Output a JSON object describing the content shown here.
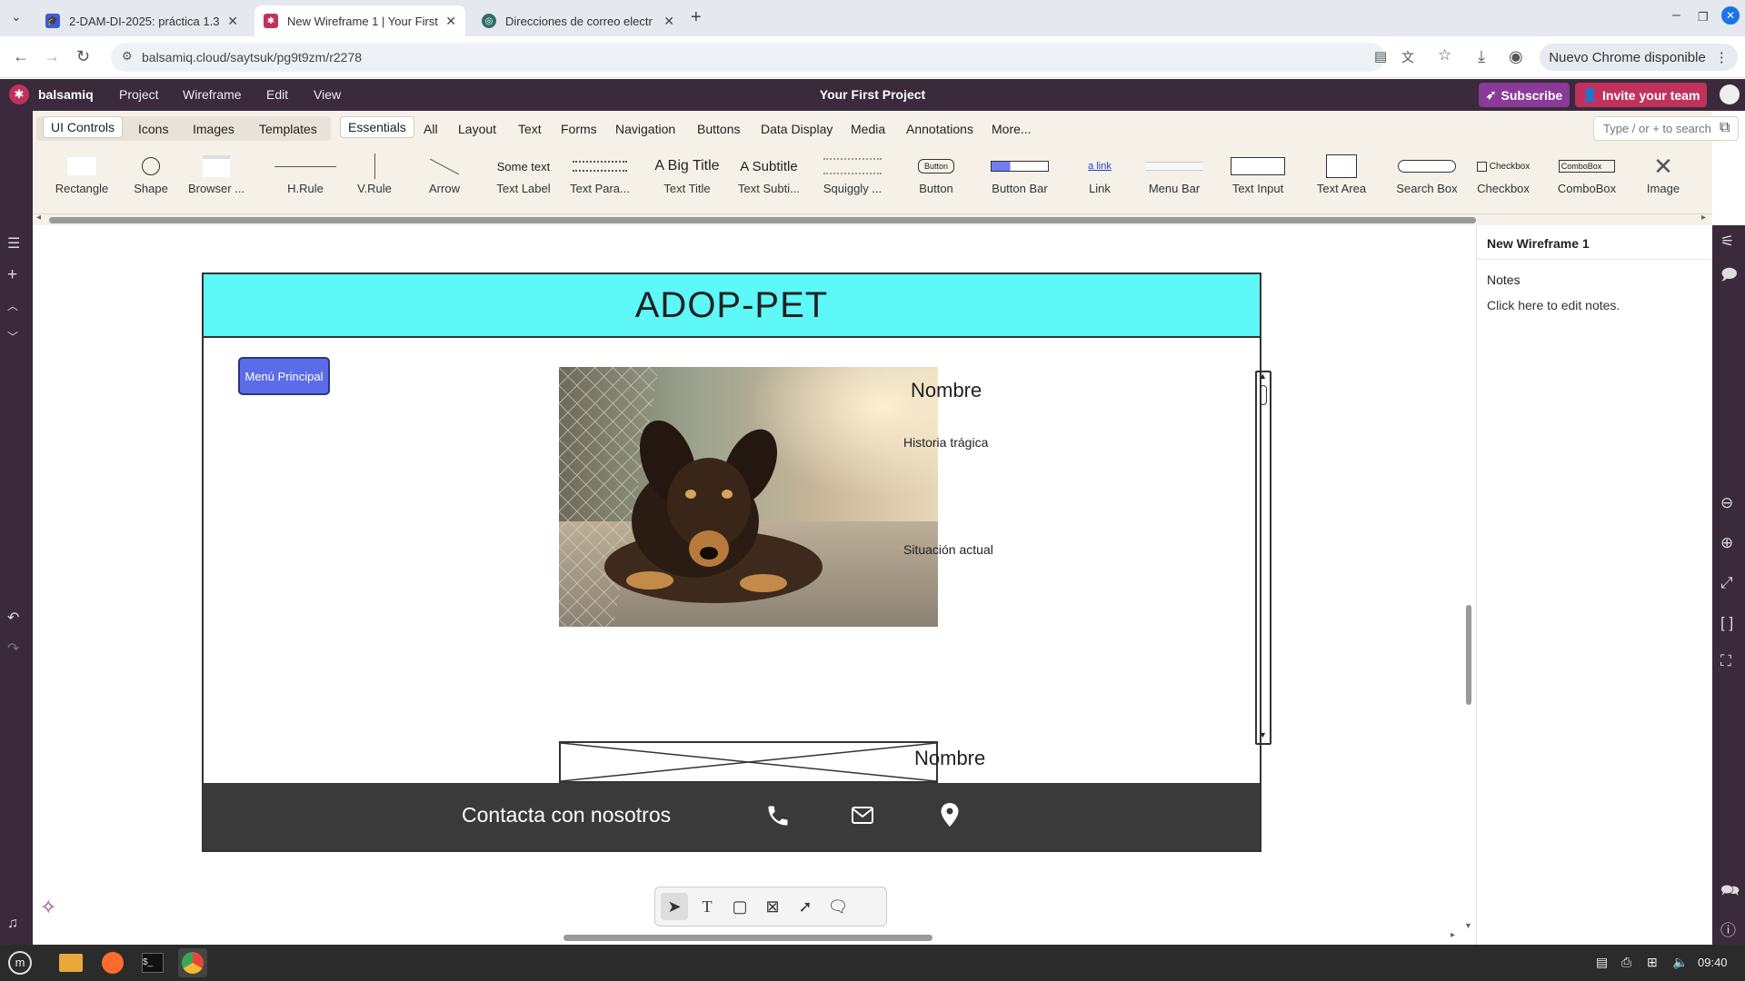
{
  "browser": {
    "tabs": [
      {
        "title": "2-DAM-DI-2025: práctica 1.3",
        "active": false
      },
      {
        "title": "New Wireframe 1 | Your First",
        "active": true
      },
      {
        "title": "Direcciones de correo electr",
        "active": false
      }
    ],
    "url": "balsamiq.cloud/saytsuk/pg9t9zm/r2278",
    "update_label": "Nuevo Chrome disponible"
  },
  "app": {
    "brand": "balsamiq",
    "menu": [
      "Project",
      "Wireframe",
      "Edit",
      "View"
    ],
    "project_title": "Your First Project",
    "subscribe_label": "Subscribe",
    "invite_label": "Invite your team"
  },
  "library": {
    "group_tabs": [
      "UI Controls",
      "Icons",
      "Images",
      "Templates"
    ],
    "category_tabs": [
      "Essentials",
      "All",
      "Layout",
      "Text",
      "Forms",
      "Navigation",
      "Buttons",
      "Data Display",
      "Media",
      "Annotations",
      "More..."
    ],
    "search_placeholder": "Type / or + to search",
    "components": [
      "Rectangle",
      "Shape",
      "Browser ...",
      "H.Rule",
      "V.Rule",
      "Arrow",
      "Text Label",
      "Text Para...",
      "Text Title",
      "Text Subti...",
      "Squiggly ...",
      "Button",
      "Button Bar",
      "Link",
      "Menu Bar",
      "Text Input",
      "Text Area",
      "Search Box",
      "Checkbox",
      "ComboBox",
      "Image"
    ],
    "previews": {
      "text_label": "Some text",
      "text_title": "A Big Title",
      "text_subtitle": "A Subtitle",
      "button": "Button",
      "link": "a link",
      "checkbox": "Checkbox",
      "combobox": "ComboBox"
    }
  },
  "wireframe": {
    "header_title": "ADOP-PET",
    "menu_button": "Menú Principal",
    "name_label_1": "Nombre",
    "story_label": "Historia trágica",
    "status_label": "Situación actual",
    "name_label_2": "Nombre",
    "footer_text": "Contacta con nosotros",
    "header_color": "#5ef8f8",
    "button_color": "#5b6ce8",
    "footer_color": "#3a3a3a"
  },
  "right_panel": {
    "title": "New Wireframe 1",
    "notes_heading": "Notes",
    "notes_placeholder": "Click here to edit notes."
  },
  "taskbar": {
    "time": "09:40"
  }
}
